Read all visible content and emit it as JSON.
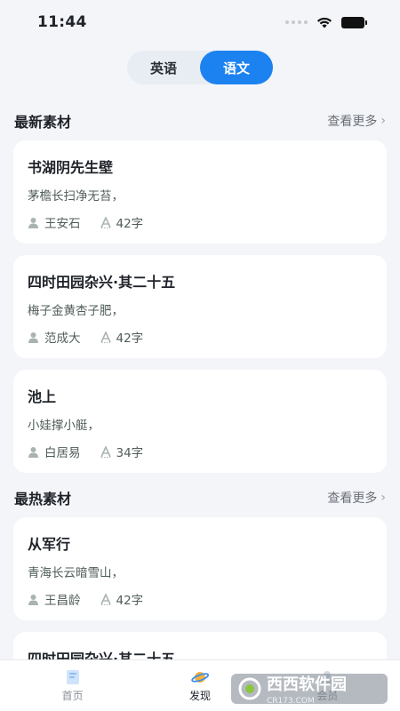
{
  "status": {
    "time": "11:44"
  },
  "segment": {
    "tabs": [
      "英语",
      "语文"
    ],
    "active_index": 1
  },
  "sections": {
    "latest": {
      "title": "最新素材",
      "more": "查看更多",
      "cards": [
        {
          "title": "书湖阴先生壁",
          "line": "茅檐长扫净无苔，",
          "author": "王安石",
          "words": "42字"
        },
        {
          "title": "四时田园杂兴·其二十五",
          "line": "梅子金黄杏子肥，",
          "author": "范成大",
          "words": "42字"
        },
        {
          "title": "池上",
          "line": "小娃撑小艇，",
          "author": "白居易",
          "words": "34字"
        }
      ]
    },
    "hot": {
      "title": "最热素材",
      "more": "查看更多",
      "cards": [
        {
          "title": "从军行",
          "line": "青海长云暗雪山，",
          "author": "王昌龄",
          "words": "42字"
        },
        {
          "title": "四时田园杂兴·其二十五",
          "line": "",
          "author": "",
          "words": ""
        }
      ]
    }
  },
  "tabbar": {
    "items": [
      {
        "label": "首页",
        "icon": "home-book-icon"
      },
      {
        "label": "发现",
        "icon": "discover-planet-icon"
      },
      {
        "label": "会员",
        "icon": "member-icon"
      }
    ],
    "active_index": 1
  },
  "watermark": {
    "text": "西西软件园",
    "sub": "CR173.COM"
  },
  "colors": {
    "accent": "#1c82f0",
    "background": "#f3f5f8",
    "card": "#ffffff"
  }
}
